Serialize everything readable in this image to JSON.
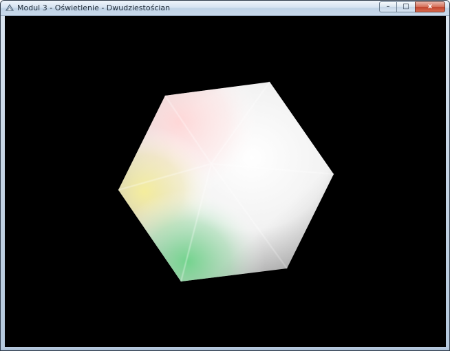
{
  "window": {
    "title": "Modul 3 - Oświetlenie - Dwudziestościan",
    "icon": "app-icon"
  },
  "caption": {
    "minimize_symbol": "–",
    "maximize_symbol": "□",
    "close_symbol": "x"
  },
  "scene": {
    "background_color": "#000000",
    "object": "icosahedron",
    "lighting": "multi-colored lights (red, yellow, green, white)"
  }
}
